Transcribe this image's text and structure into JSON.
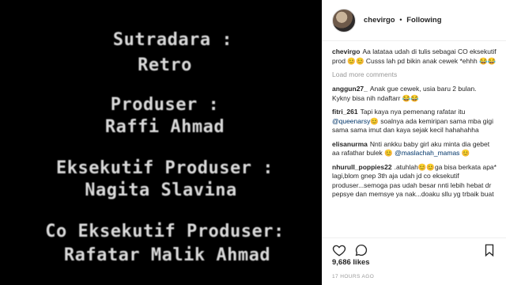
{
  "credits": {
    "lines": [
      "Sutradara :",
      "Retro",
      "Produser :",
      "Raffi Ahmad",
      "Eksekutif Produser :",
      "Nagita Slavina",
      "Co Eksekutif Produser:",
      "Rafatar Malik Ahmad"
    ]
  },
  "post": {
    "username": "chevirgo",
    "separator": "•",
    "follow_status": "Following",
    "caption": {
      "user": "chevirgo",
      "text": "Aa latataa udah di tulis sebagai CO eksekutif prod 😊😊 Cusss lah pd bikin anak cewek *ehhh 😂😂"
    },
    "load_more": "Load more comments",
    "comments": [
      {
        "user": "anggun27_",
        "text": "Anak gue cewek, usia baru 2 bulan. Kykny bisa nih ndaftarr 😂😂",
        "mention": ""
      },
      {
        "user": "fitri_261",
        "text_before": "Tapi kaya nya pemenang rafatar itu ",
        "mention": "@queenarsy",
        "text": "😊 soalnya ada kemiripan sama mba gigi sama sama imut dan kaya sejak kecil hahahahha"
      },
      {
        "user": "elisanurma",
        "text_before": "Nnti ankku baby girl aku minta dia gebet aa rafathar bulek 😊 ",
        "mention": "@maslachah_mamas",
        "text": " 😊"
      },
      {
        "user": "nhurull_poppies22",
        "text": ".atuhlah😊😊ga bisa berkata apa* lagi,blom gnep 3th aja udah jd co eksekutif produser...semoga pas udah besar nnti lebih hebat dr pepsye dan memsye ya nak...doaku sllu yg trbaik buat"
      }
    ],
    "likes": "9,686 likes",
    "timestamp": "17 HOURS AGO"
  },
  "icons": {
    "like": "heart-icon",
    "comment": "comment-icon",
    "save": "bookmark-icon"
  }
}
